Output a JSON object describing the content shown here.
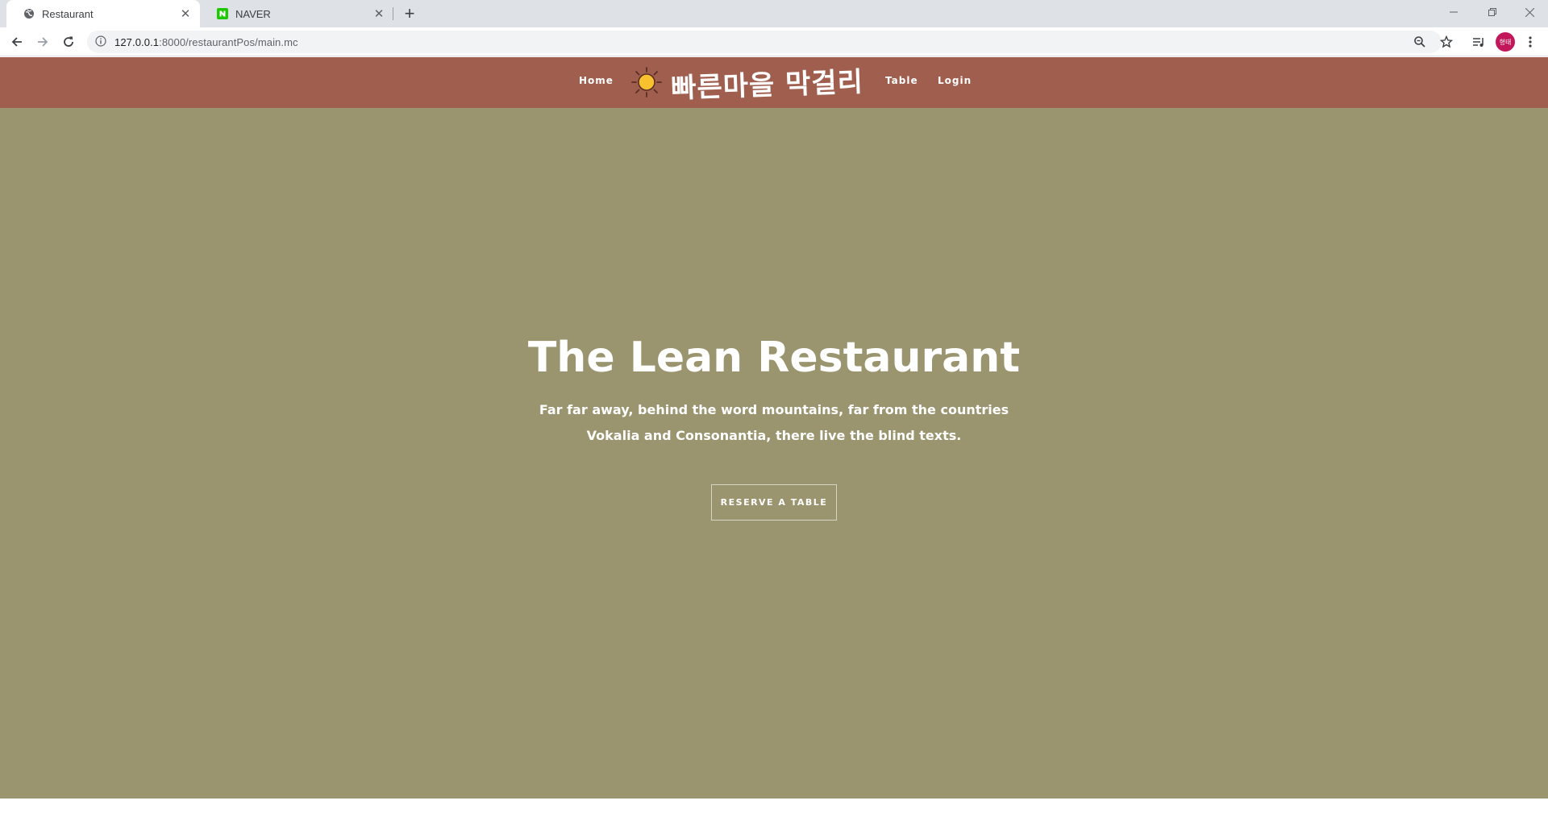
{
  "browser": {
    "tabs": [
      {
        "title": "Restaurant",
        "favicon": "globe-icon",
        "active": true
      },
      {
        "title": "NAVER",
        "favicon": "naver-icon",
        "active": false
      }
    ],
    "new_tab_label": "+",
    "url_host": "127.0.0.1",
    "url_path": ":8000/restaurantPos/main.mc",
    "profile_initials": "형태"
  },
  "site": {
    "nav": {
      "home": "Home",
      "logo_text": "빠른마을 막걸리",
      "logo_icon": "sun-icon",
      "table": "Table",
      "login": "Login"
    },
    "hero": {
      "title": "The Lean Restaurant",
      "subtitle_line1": "Far far away, behind the word mountains, far from the countries",
      "subtitle_line2": "Vokalia and Consonantia, there live the blind texts.",
      "cta": "RESERVE A TABLE"
    }
  },
  "colors": {
    "nav_bg": "#a05f4e",
    "hero_bg": "#9a946f",
    "sun": "#f9c12e"
  }
}
